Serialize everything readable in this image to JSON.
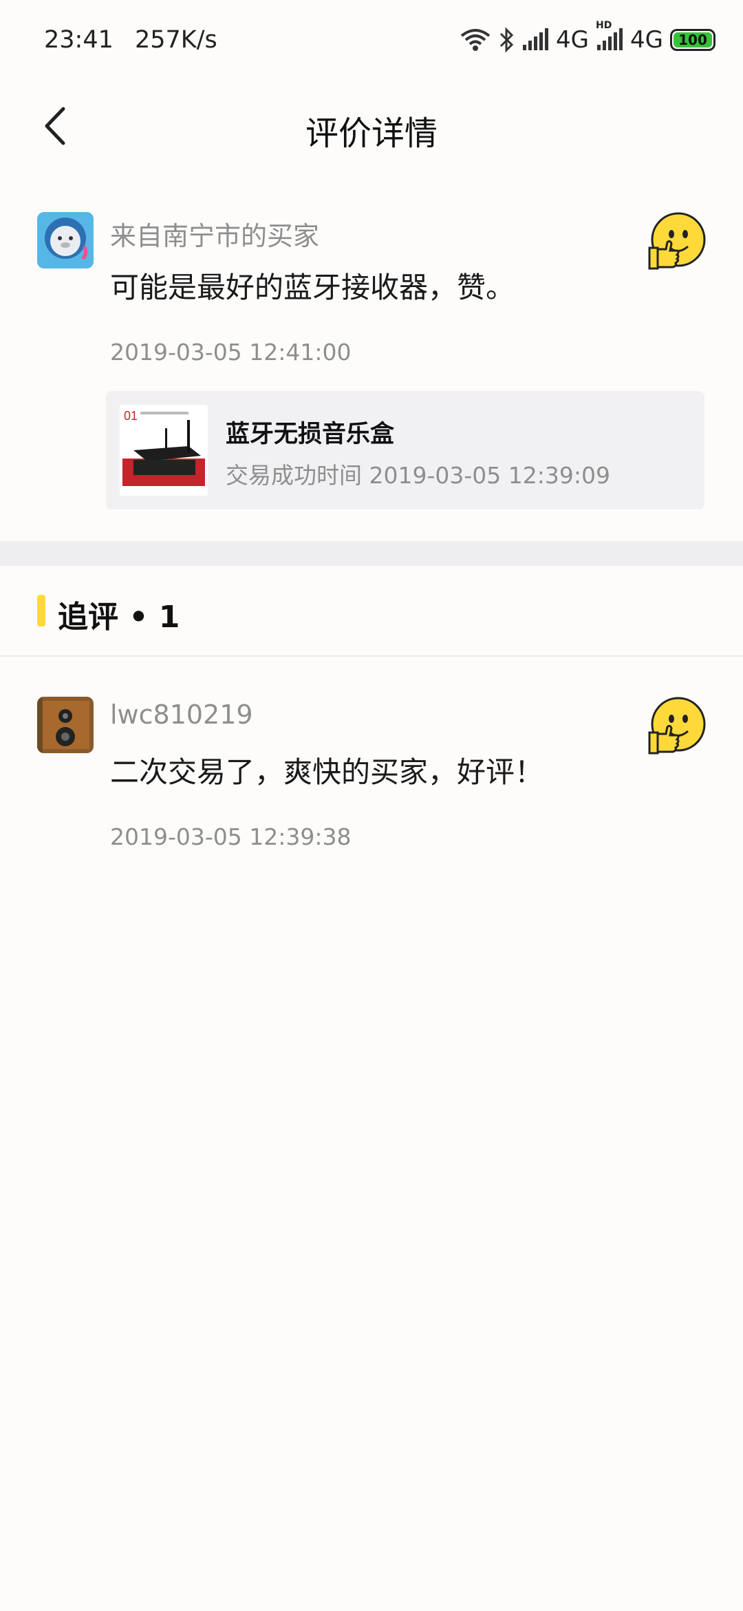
{
  "status_bar": {
    "time": "23:41",
    "speed": "257K/s",
    "network1": "4G",
    "network2": "4G",
    "hd": "HD",
    "battery": "100",
    "icons": [
      "wifi-icon",
      "bluetooth-icon",
      "signal-icon",
      "signal-icon"
    ]
  },
  "header": {
    "title": "评价详情",
    "back_icon": "chevron-left-icon"
  },
  "review": {
    "reviewer": "来自南宁市的买家",
    "text": "可能是最好的蓝牙接收器，赞。",
    "time": "2019-03-05 12:41:00",
    "rating_icon": "thumbs-up-emoji-icon",
    "product": {
      "name": "蓝牙无损音乐盒",
      "trade_time": "交易成功时间 2019-03-05 12:39:09"
    }
  },
  "follow_up_section": {
    "title": "追评 • 1"
  },
  "follow_up": {
    "reviewer": "lwc810219",
    "text": "二次交易了，爽快的买家，好评！",
    "time": "2019-03-05 12:39:38",
    "rating_icon": "thumbs-up-emoji-icon"
  },
  "colors": {
    "accent": "#ffd93a",
    "battery": "#37c23a",
    "muted_text": "#8e8e8e"
  }
}
